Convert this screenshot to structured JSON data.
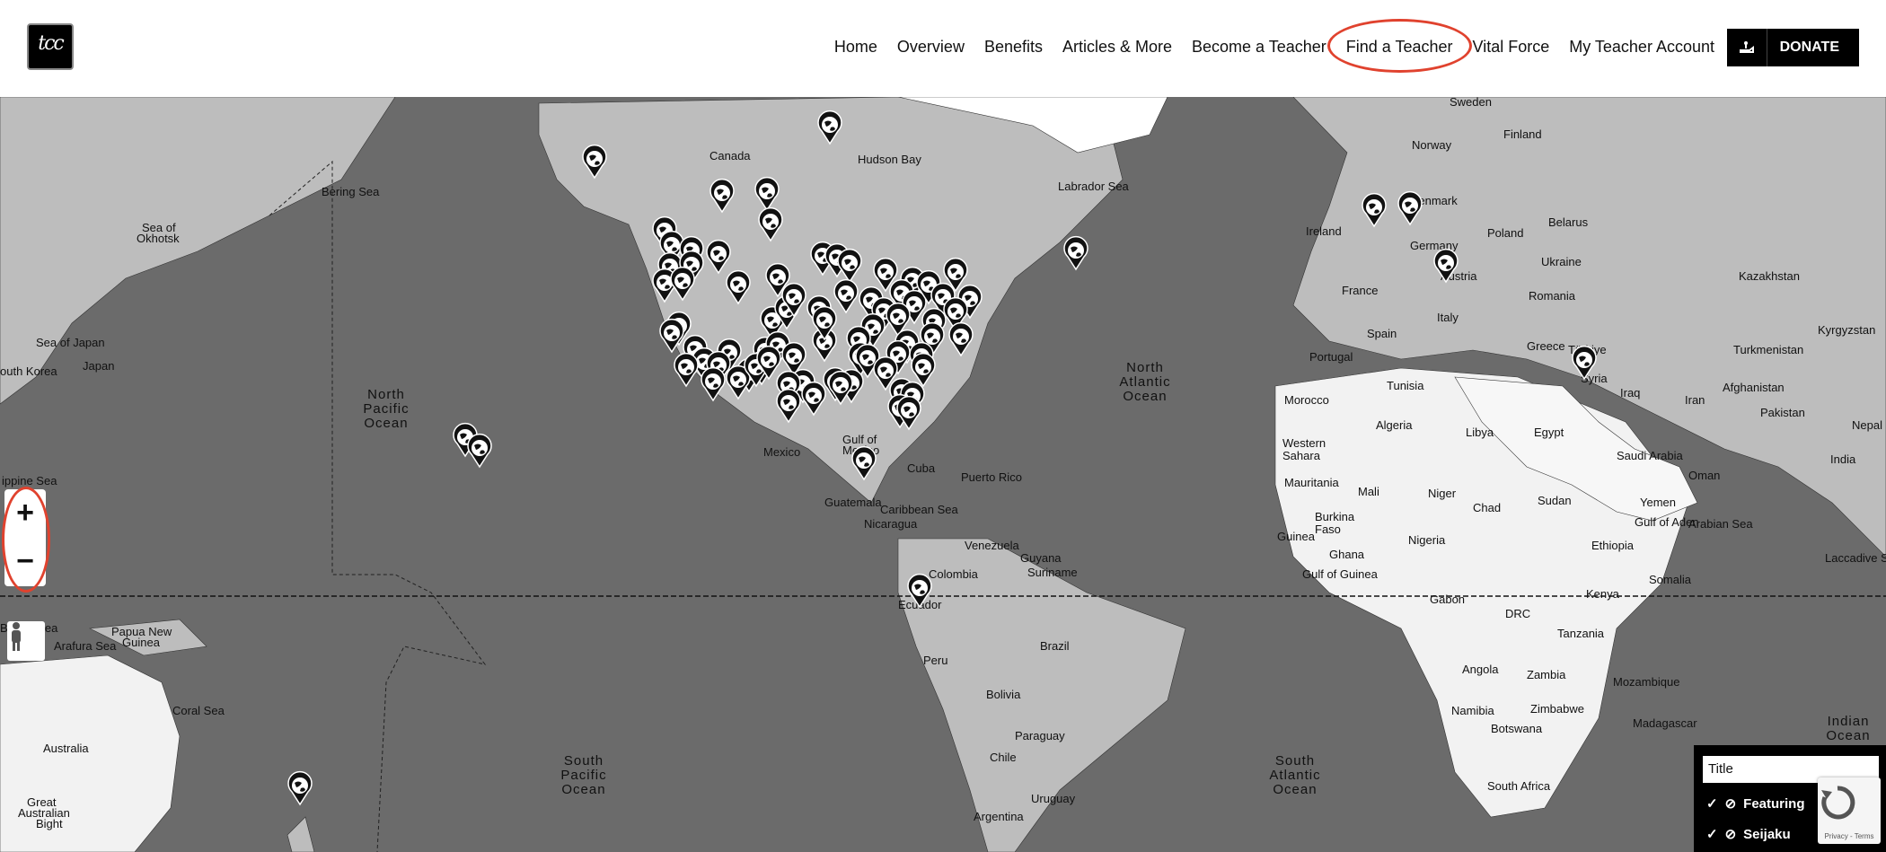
{
  "header": {
    "logo_text": "tcc",
    "nav": [
      {
        "label": "Home"
      },
      {
        "label": "Overview"
      },
      {
        "label": "Benefits"
      },
      {
        "label": "Articles & More"
      },
      {
        "label": "Become a Teacher"
      },
      {
        "label": "Find a Teacher",
        "highlighted": true
      },
      {
        "label": "Vital Force"
      },
      {
        "label": "My Teacher Account"
      }
    ],
    "donate_label": "DONATE"
  },
  "map": {
    "zoom_in": "+",
    "zoom_out": "−",
    "labels": {
      "oceans": [
        "North Pacific Ocean",
        "South Pacific Ocean",
        "North Atlantic Ocean",
        "South Atlantic Ocean",
        "Indian Ocean"
      ],
      "seas": [
        "Bering Sea",
        "Sea of Okhotsk",
        "Sea of Japan",
        "Labrador Sea",
        "Hudson Bay",
        "Gulf of Mexico",
        "Caribbean Sea",
        "Coral Sea",
        "Banda Sea",
        "Arafura Sea",
        "Arabian Sea",
        "Gulf of Aden",
        "Gulf of Guinea",
        "Laccadive Sea",
        "Great Australian Bight",
        "Philippine Sea"
      ],
      "countries": [
        "Canada",
        "Mexico",
        "Cuba",
        "Puerto Rico",
        "Guatemala",
        "Nicaragua",
        "Venezuela",
        "Guyana",
        "Suriname",
        "Colombia",
        "Ecuador",
        "Peru",
        "Brazil",
        "Bolivia",
        "Paraguay",
        "Chile",
        "Uruguay",
        "Argentina",
        "Sweden",
        "Finland",
        "Norway",
        "Denmark",
        "Ireland",
        "Germany",
        "Poland",
        "Belarus",
        "Ukraine",
        "France",
        "Austria",
        "Italy",
        "Romania",
        "Spain",
        "Portugal",
        "Greece",
        "Türkiye",
        "Syria",
        "Iraq",
        "Iran",
        "Kazakhstan",
        "Kyrgyzstan",
        "Turkmenistan",
        "Afghanistan",
        "Pakistan",
        "Nepal",
        "India",
        "Morocco",
        "Tunisia",
        "Algeria",
        "Libya",
        "Egypt",
        "Western Sahara",
        "Mauritania",
        "Mali",
        "Niger",
        "Chad",
        "Sudan",
        "Saudi Arabia",
        "Yemen",
        "Oman",
        "Burkina Faso",
        "Guinea",
        "Ghana",
        "Nigeria",
        "Ethiopia",
        "Somalia",
        "Kenya",
        "Gabon",
        "DRC",
        "Tanzania",
        "Angola",
        "Zambia",
        "Mozambique",
        "Zimbabwe",
        "Namibia",
        "Botswana",
        "Madagascar",
        "South Africa",
        "Australia",
        "Papua New Guinea",
        "South Korea",
        "Japan"
      ]
    }
  },
  "legend": {
    "title_placeholder": "Title",
    "items": [
      "Featuring",
      "Seijaku"
    ]
  },
  "recaptcha": {
    "privacy": "Privacy",
    "terms": "Terms"
  }
}
